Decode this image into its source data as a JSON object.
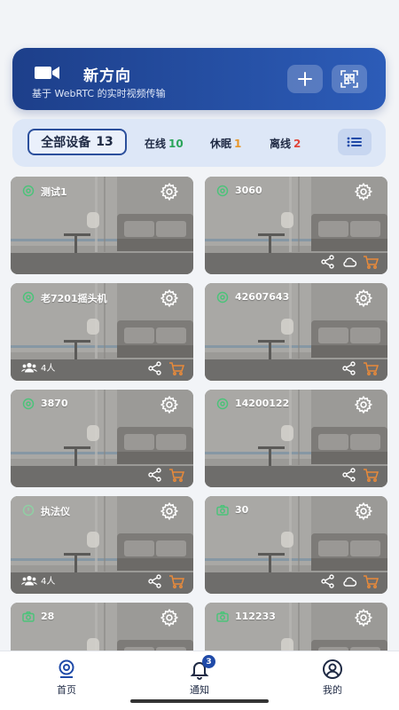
{
  "header": {
    "title": "新方向",
    "subtitle": "基于 WebRTC 的实时视频传输",
    "brand_color": "#1d3f8a",
    "icons": {
      "app": "video-camera-icon",
      "add": "plus-icon",
      "scan": "qr-scan-icon"
    }
  },
  "filters": {
    "all_label": "全部设备",
    "all_count": "13",
    "online_label": "在线",
    "online_count": "10",
    "sleep_label": "休眠",
    "sleep_count": "1",
    "offline_label": "离线",
    "offline_count": "2",
    "list_icon": "list-view-icon"
  },
  "devices": [
    {
      "name": "测试1",
      "status_icon": "wifi-online-icon",
      "viewers": "",
      "actions": []
    },
    {
      "name": "3060",
      "status_icon": "wifi-online-icon",
      "viewers": "",
      "actions": [
        "share-icon",
        "cloud-icon",
        "cart-icon"
      ]
    },
    {
      "name": "老7201摇头机",
      "status_icon": "wifi-online-icon",
      "viewers": "4人",
      "actions": [
        "share-icon",
        "cart-icon"
      ]
    },
    {
      "name": "42607643",
      "status_icon": "wifi-online-icon",
      "viewers": "",
      "actions": [
        "share-icon",
        "cart-icon"
      ]
    },
    {
      "name": "3870",
      "status_icon": "wifi-online-icon",
      "viewers": "",
      "actions": [
        "share-icon",
        "cart-icon"
      ]
    },
    {
      "name": "14200122",
      "status_icon": "wifi-online-icon",
      "viewers": "",
      "actions": [
        "share-icon",
        "cart-icon"
      ]
    },
    {
      "name": "执法仪",
      "status_icon": "sleep-icon",
      "viewers": "4人",
      "actions": [
        "share-icon",
        "cart-icon"
      ]
    },
    {
      "name": "30",
      "status_icon": "camera-online-icon",
      "viewers": "",
      "actions": [
        "share-icon",
        "cloud-icon",
        "cart-icon"
      ]
    },
    {
      "name": "28",
      "status_icon": "camera-online-icon",
      "viewers": "",
      "actions": []
    },
    {
      "name": "112233",
      "status_icon": "camera-online-icon",
      "viewers": "",
      "actions": []
    }
  ],
  "nav": {
    "home_label": "首页",
    "notice_label": "通知",
    "notice_badge": "3",
    "mine_label": "我的"
  }
}
